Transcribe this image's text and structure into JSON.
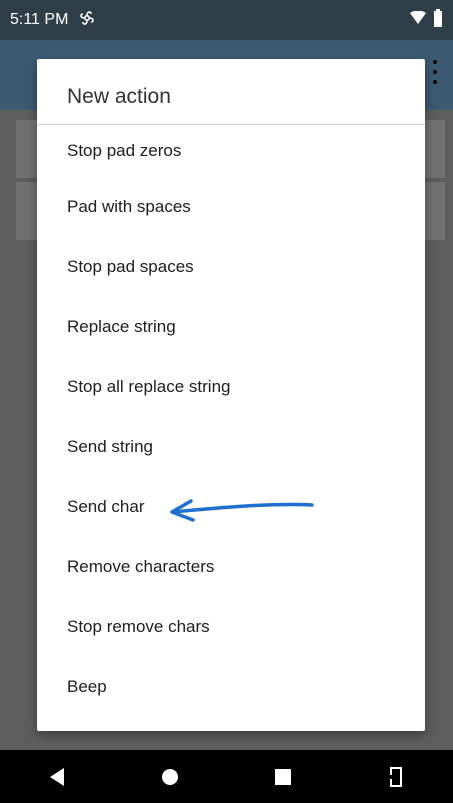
{
  "status_bar": {
    "time": "5:11 PM",
    "icons": [
      "pinwheel-icon",
      "wifi-icon",
      "battery-icon"
    ]
  },
  "dialog": {
    "title": "New action",
    "items": [
      "Stop pad zeros",
      "Pad with spaces",
      "Stop pad spaces",
      "Replace string",
      "Stop all replace string",
      "Send string",
      "Send char",
      "Remove characters",
      "Stop remove chars",
      "Beep"
    ]
  },
  "annotation": {
    "color": "#1f6fd1",
    "points_to": "Send char"
  },
  "nav_bar": {
    "buttons": [
      "back-icon",
      "home-icon",
      "recents-icon",
      "rotate-icon"
    ]
  }
}
